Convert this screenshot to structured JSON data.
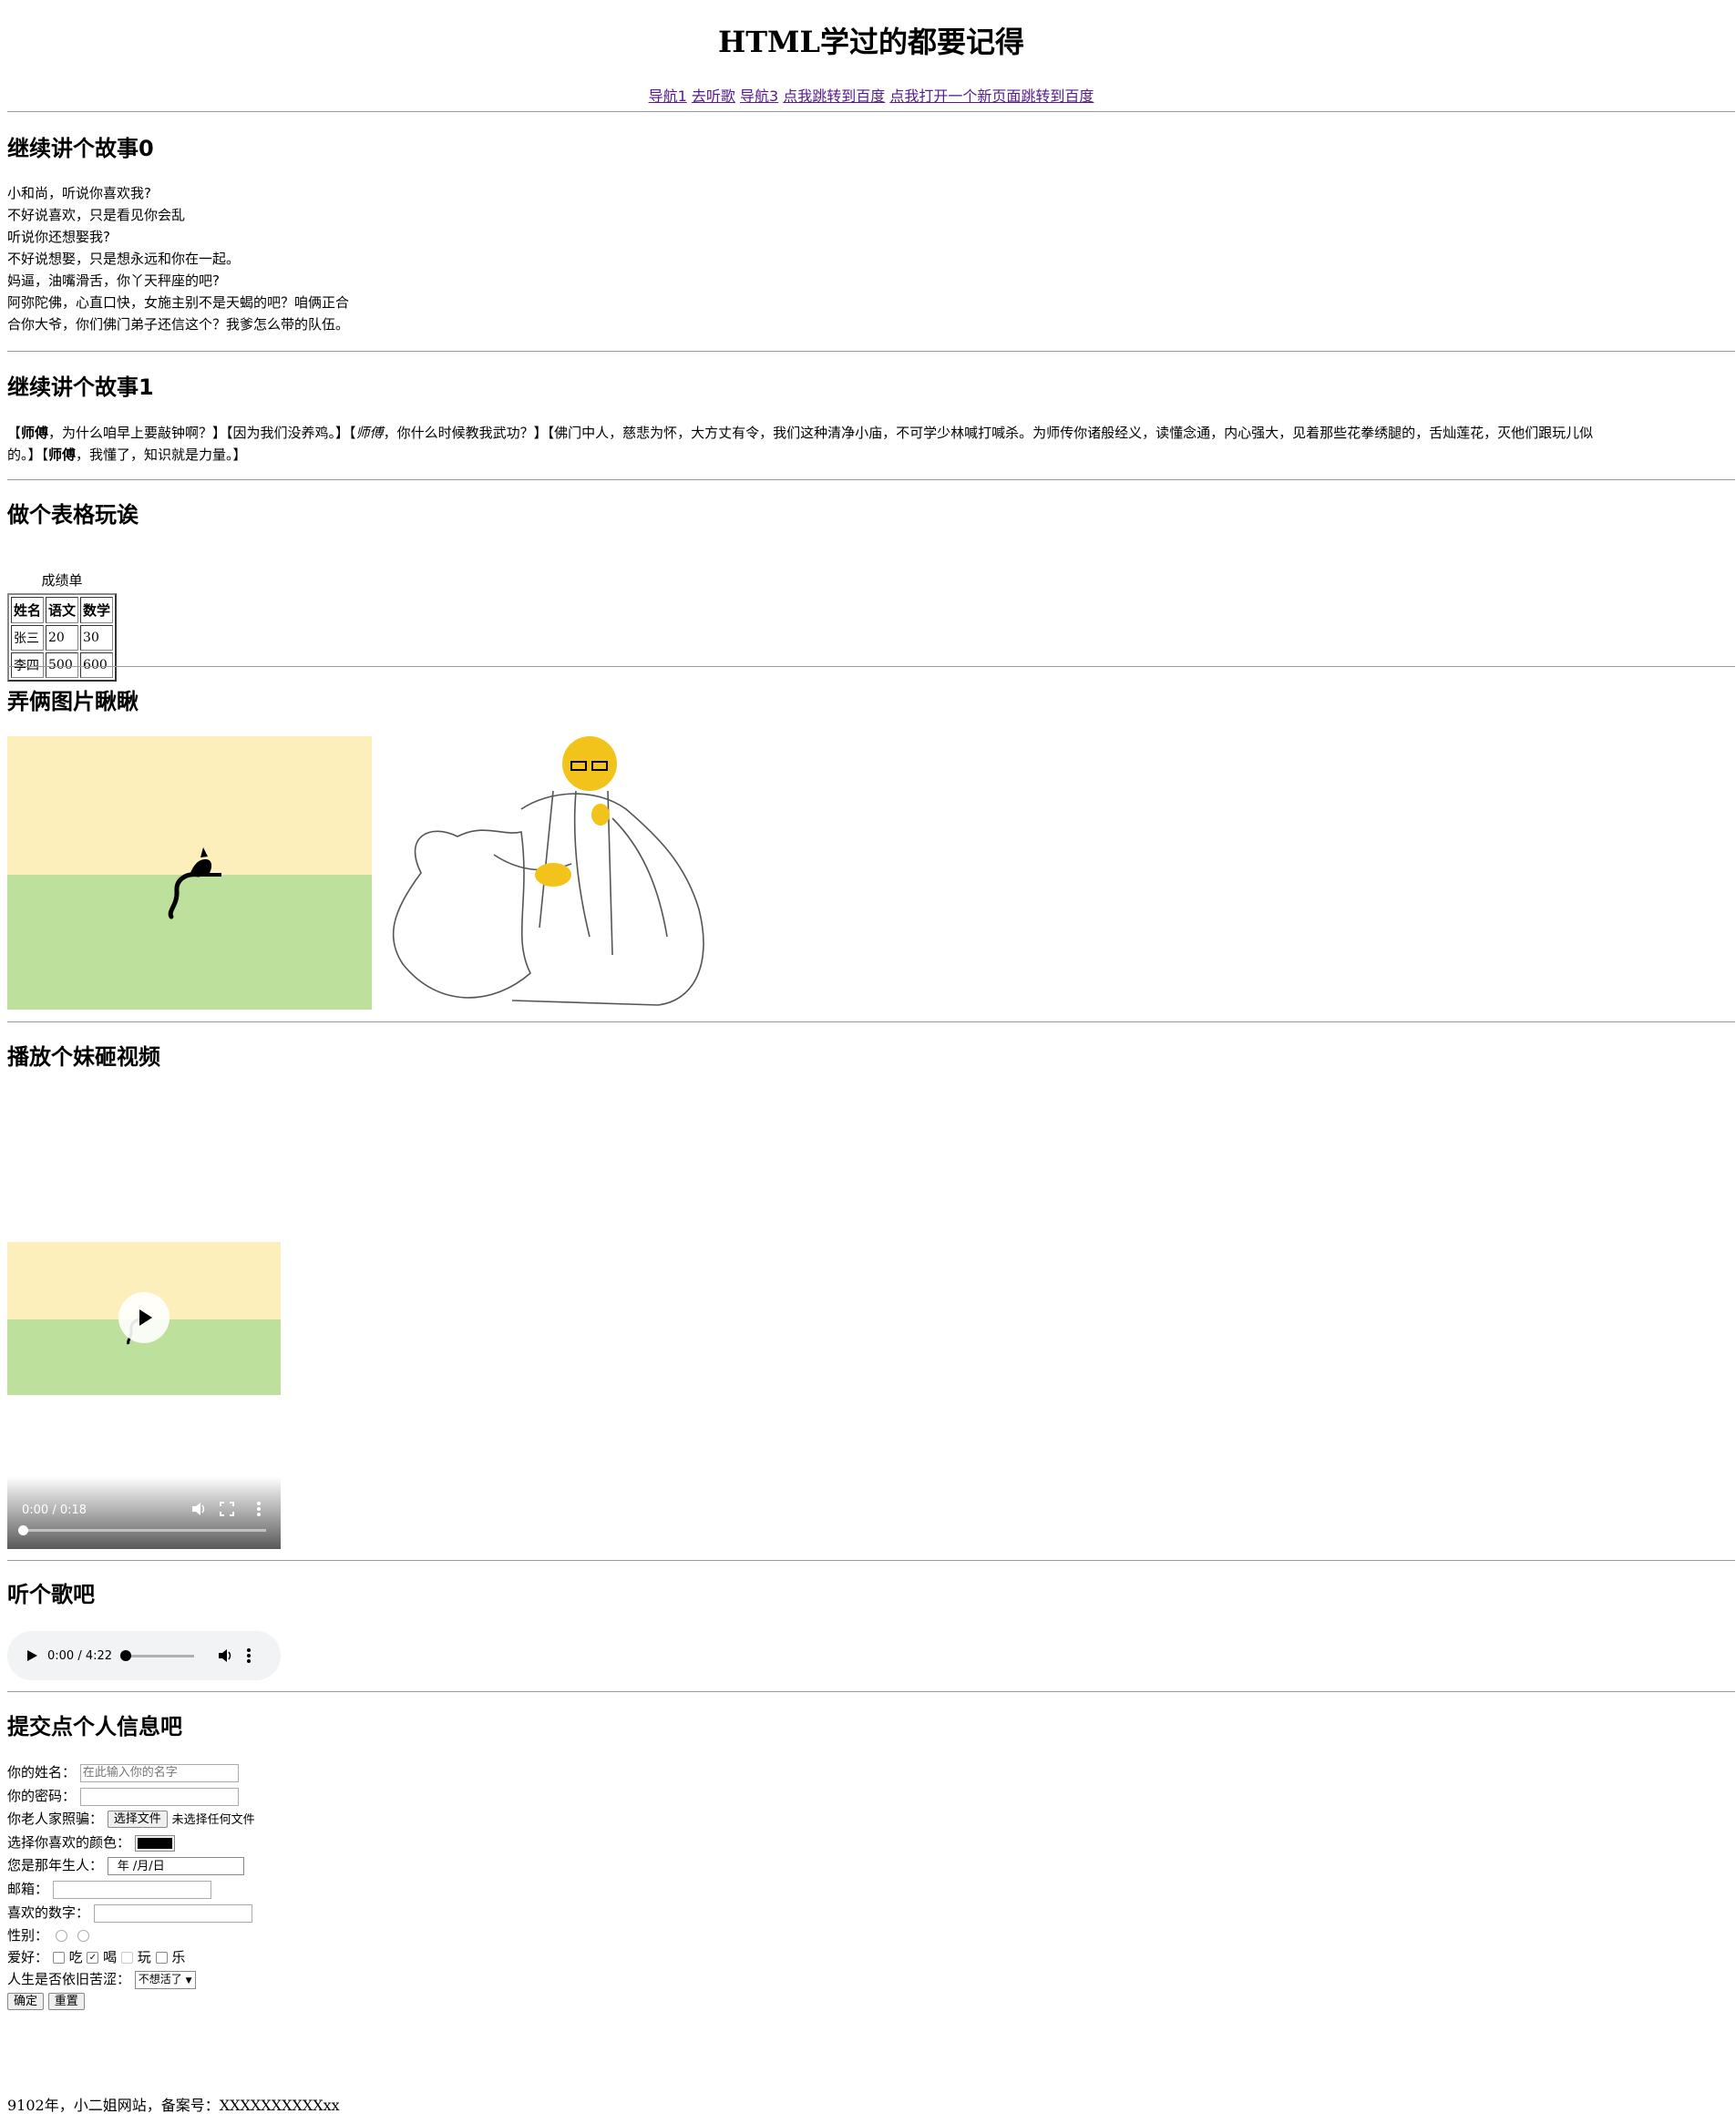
{
  "page_title": "HTML学过的都要记得",
  "nav": [
    "导航1",
    "去听歌",
    "导航3",
    "点我跳转到百度",
    "点我打开一个新页面跳转到百度"
  ],
  "section0": {
    "title": "继续讲个故事0",
    "lines": [
      "小和尚，听说你喜欢我?",
      "不好说喜欢，只是看见你会乱",
      "听说你还想娶我?",
      "不好说想娶，只是想永远和你在一起。",
      "妈逼，油嘴滑舌，你丫天秤座的吧?",
      "阿弥陀佛，心直口快，女施主别不是天蝎的吧？咱俩正合",
      "合你大爷，你们佛门弟子还信这个？我爹怎么带的队伍。"
    ]
  },
  "section1": {
    "title": "继续讲个故事1",
    "b1": "师傅",
    "t1": "，为什么咱早上要敲钟啊？】【因为我们没养鸡。】【",
    "i1": "师傅",
    "t2": "，你什么时候教我武功？】【佛门中人，慈悲为怀，大方丈有令，我们这种清净小庙，不可学少林喊打喊杀。为师传你诸般经义，读懂念通，内心强大，见着那些花拳绣腿的，舌灿莲花，灭他们跟玩儿似",
    "t3": "的。】【",
    "b2": "师傅",
    "t4": "，我懂了，知识就是力量。】"
  },
  "table_section": {
    "title": "做个表格玩诶",
    "caption": "成绩单",
    "headers": [
      "姓名",
      "语文",
      "数学"
    ],
    "rows": [
      [
        "张三",
        "20",
        "30"
      ],
      [
        "李四",
        "500",
        "600"
      ]
    ]
  },
  "images_section": {
    "title": "弄俩图片瞅瞅"
  },
  "video_section": {
    "title": "播放个妹砸视频",
    "time": "0:00 / 0:18"
  },
  "audio_section": {
    "title": "听个歌吧",
    "time": "0:00 / 4:22"
  },
  "form_section": {
    "title": "提交点个人信息吧",
    "name_label": "你的姓名：",
    "name_placeholder": "在此输入你的名字",
    "password_label": "你的密码：",
    "photo_label": "你老人家照骗：",
    "file_button": "选择文件",
    "file_status": "未选择任何文件",
    "color_label": "选择你喜欢的颜色：",
    "color_value": "#000000",
    "birth_label": "您是那年生人：",
    "birth_value": "年 /月/日",
    "email_label": "邮箱：",
    "number_label": "喜欢的数字：",
    "gender_label": "性别：",
    "hobby_label": "爱好：",
    "hobbies": [
      "吃",
      "喝",
      "玩",
      "乐"
    ],
    "hobby_checked": [
      false,
      true,
      false,
      false
    ],
    "life_label": "人生是否依旧苦涩：",
    "life_option": "不想活了",
    "submit": "确定",
    "reset": "重置"
  },
  "footer": "9102年，小二姐网站，备案号：XXXXXXXXXXxx"
}
